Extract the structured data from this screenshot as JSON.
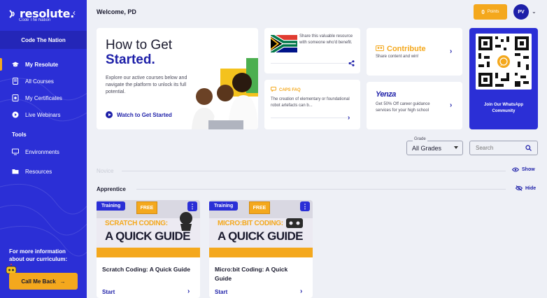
{
  "sidebar": {
    "logo": "resolute.",
    "logo_sub": "Code The Nation",
    "org": "Code The Nation",
    "nav": [
      {
        "label": "My Resolute",
        "icon": "graduation-cap-icon"
      },
      {
        "label": "All Courses",
        "icon": "courses-icon"
      },
      {
        "label": "My Certificates",
        "icon": "certificate-icon"
      },
      {
        "label": "Live Webinars",
        "icon": "play-circle-icon"
      }
    ],
    "tools_label": "Tools",
    "tools": [
      {
        "label": "Environments",
        "icon": "monitor-icon"
      },
      {
        "label": "Resources",
        "icon": "folder-icon"
      }
    ],
    "more_info": "For more information about our curriculum:",
    "call_me_back": "Call Me Back"
  },
  "header": {
    "welcome": "Welcome, PD",
    "points_value": "0",
    "points_label": "Points",
    "avatar_initials": "PV"
  },
  "hero": {
    "title_line1": "How to Get",
    "title_line2": "Started.",
    "description": "Explore our active courses below and navigate the platform to unlock its full potential.",
    "watch_label": "Watch to Get Started"
  },
  "cards": {
    "share_text": "Share this valuable resource with someone who'd benefit.",
    "caps_title": "CAPS FAQ",
    "caps_text": "The creation of elementary or foundational robot artefacts can b...",
    "contribute_title": "Contribute",
    "contribute_sub": "Share content and win!",
    "yenza_logo": "Yenza",
    "yenza_text": "Get 50% Off career guidance services for your high school",
    "whatsapp_text": "Join Our WhatsApp Community"
  },
  "filters": {
    "grade_label": "Grade",
    "grade_value": "All Grades",
    "search_placeholder": "Search"
  },
  "sections": {
    "novice": "Novice",
    "show": "Show",
    "apprentice": "Apprentice",
    "hide": "Hide"
  },
  "courses": [
    {
      "badge": "Training",
      "free": "FREE",
      "thumb_title": "SCRATCH CODING:",
      "thumb_guide": "A QUICK GUIDE",
      "title": "Scratch Coding: A Quick Guide",
      "start": "Start"
    },
    {
      "badge": "Training",
      "free": "FREE",
      "thumb_title": "MICRO:BIT CODING:",
      "thumb_guide": "A QUICK GUIDE",
      "title": "Micro:bit Coding: A Quick Guide",
      "start": "Start"
    }
  ],
  "colors": {
    "brand_blue": "#2b2fd6",
    "accent_orange": "#f4a81d",
    "text_blue": "#1d1fa8"
  }
}
